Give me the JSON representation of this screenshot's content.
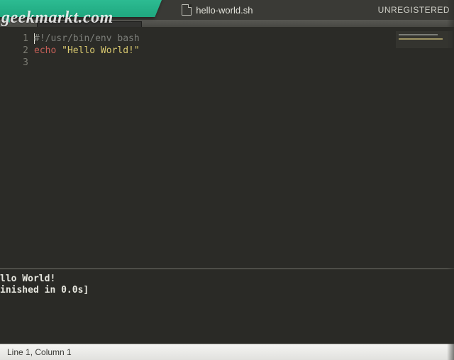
{
  "tabbar": {
    "filename": "hello-world.sh",
    "status": "UNREGISTERED"
  },
  "openFilesTab": {
    "label": "hello-world.sh"
  },
  "gutter": [
    "1",
    "2",
    "3"
  ],
  "code": {
    "line1_comment": "#!/usr/bin/env bash",
    "line2_keyword": "echo",
    "line2_string": "\"Hello World!\""
  },
  "output": {
    "line1": "llo World!",
    "line2": "inished in 0.0s]"
  },
  "statusbar": {
    "position": "Line 1, Column 1"
  },
  "watermark": {
    "text": "geekmarkt.com"
  }
}
